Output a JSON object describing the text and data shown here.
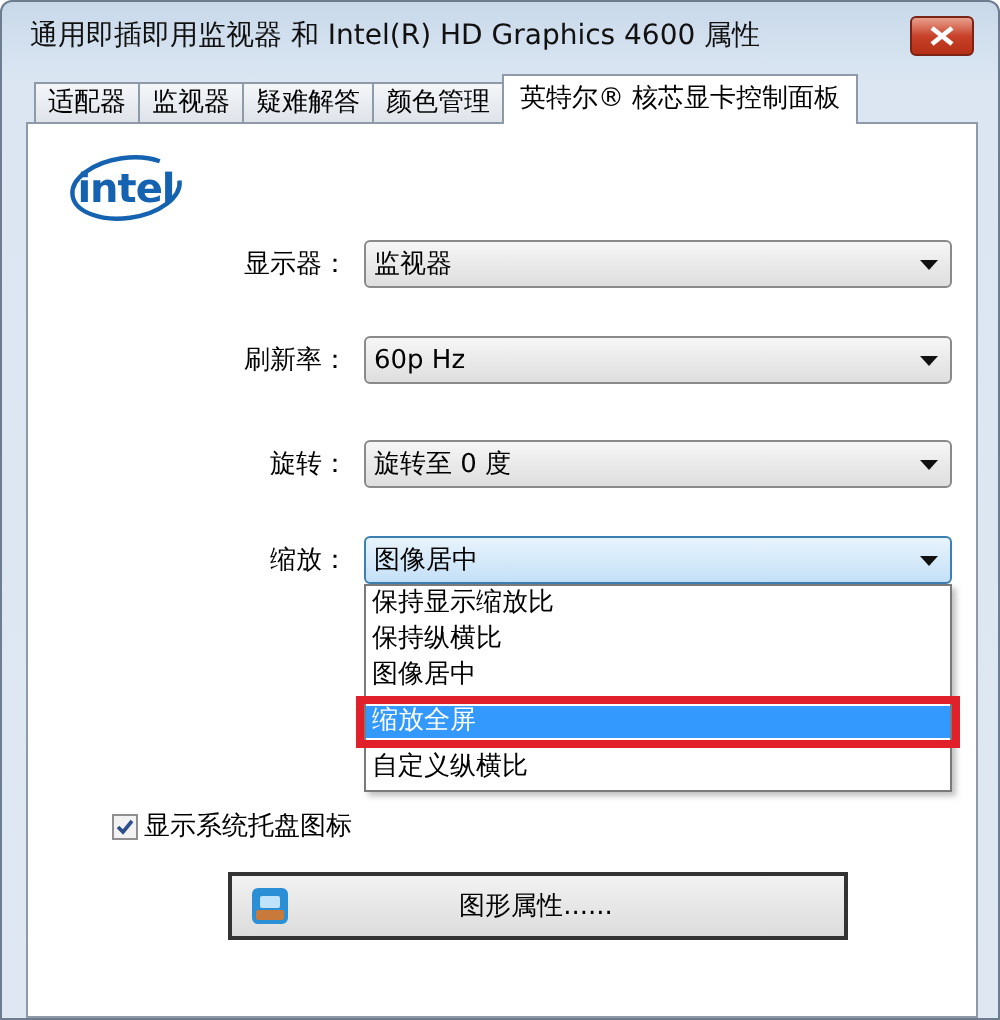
{
  "window": {
    "title": "通用即插即用监视器 和 Intel(R) HD Graphics 4600 属性"
  },
  "tabs": [
    {
      "label": "适配器",
      "selected": false
    },
    {
      "label": "监视器",
      "selected": false
    },
    {
      "label": "疑难解答",
      "selected": false
    },
    {
      "label": "颜色管理",
      "selected": false
    },
    {
      "label": "英特尔® 核芯显卡控制面板",
      "selected": true
    }
  ],
  "logo": {
    "text": "intel"
  },
  "settings": [
    {
      "label": "显示器：",
      "value": "监视器",
      "expanded": false
    },
    {
      "label": "刷新率：",
      "value": "60p Hz",
      "expanded": false
    },
    {
      "label": "旋转：",
      "value": "旋转至 0 度",
      "expanded": false
    },
    {
      "label": "缩放：",
      "value": "图像居中",
      "expanded": true
    }
  ],
  "dropdown_options": [
    {
      "label": "保持显示缩放比",
      "selected": false,
      "annotated": false
    },
    {
      "label": "保持纵横比",
      "selected": false,
      "annotated": false
    },
    {
      "label": "图像居中",
      "selected": false,
      "annotated": false
    },
    {
      "label": "缩放全屏",
      "selected": true,
      "annotated": true
    },
    {
      "label": "自定义纵横比",
      "selected": false,
      "annotated": false
    }
  ],
  "checkbox": {
    "label": "显示系统托盘图标",
    "checked": true
  },
  "button": {
    "label": "图形属性......"
  }
}
